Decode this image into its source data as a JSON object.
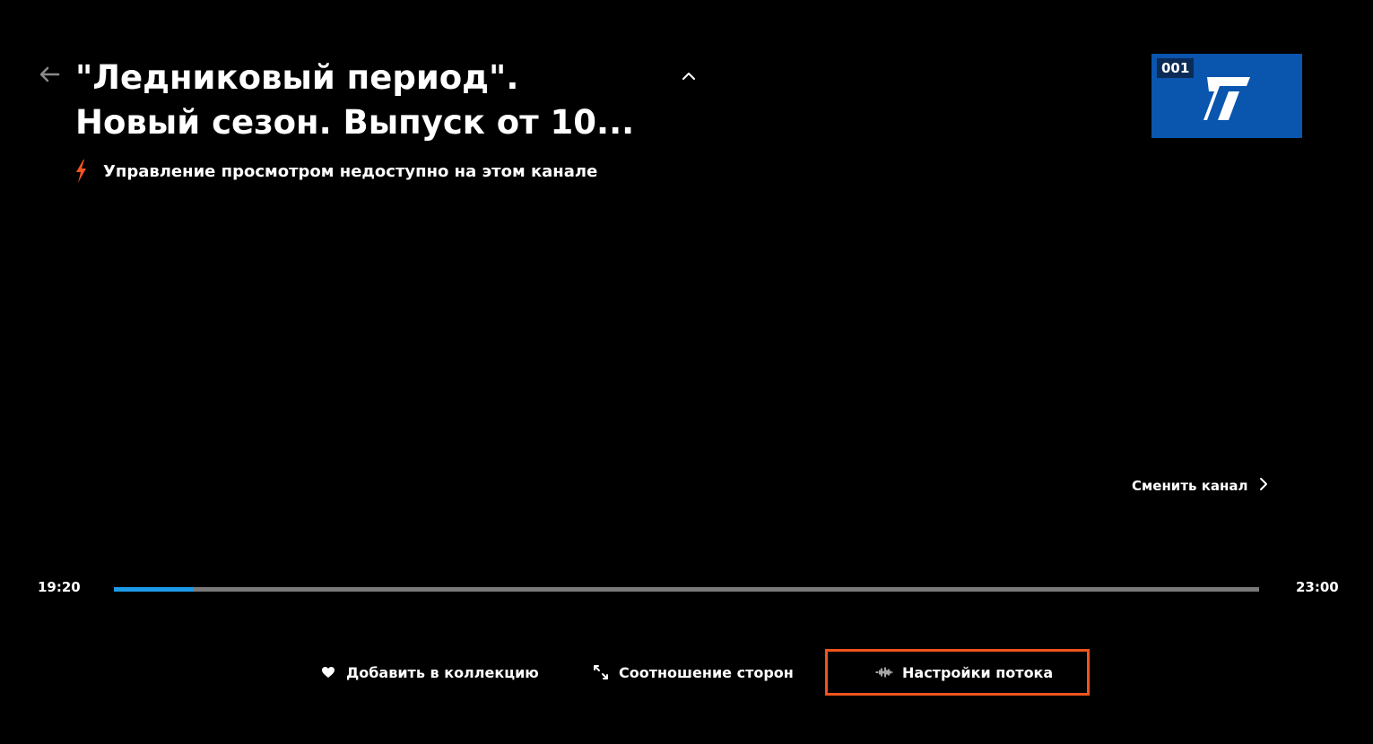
{
  "player": {
    "title": "\"Ледниковый период\".\nНовый сезон. Выпуск от 10...",
    "notice": "Управление просмотром недоступно на этом канале",
    "notice_icon": "lightning-icon",
    "back_icon": "arrow-left-icon",
    "collapse_icon": "chevron-up-icon"
  },
  "channel": {
    "number": "001",
    "logo": "channel-one-logo",
    "brand_color": "#0a55ad"
  },
  "switch_channel": {
    "label": "Сменить канал",
    "icon": "chevron-right-icon"
  },
  "timeline": {
    "start": "19:20",
    "end": "23:00",
    "progress_fraction": 0.07,
    "progress_color": "#1e9be8"
  },
  "actions": {
    "collection": {
      "label": "Добавить в коллекцию",
      "icon": "heart-icon"
    },
    "aspect": {
      "label": "Соотношение сторон",
      "icon": "aspect-ratio-icon"
    },
    "stream": {
      "label": "Настройки потока",
      "icon": "waveform-icon",
      "focused": true
    }
  },
  "colors": {
    "accent": "#f0541e",
    "background": "#000000"
  }
}
